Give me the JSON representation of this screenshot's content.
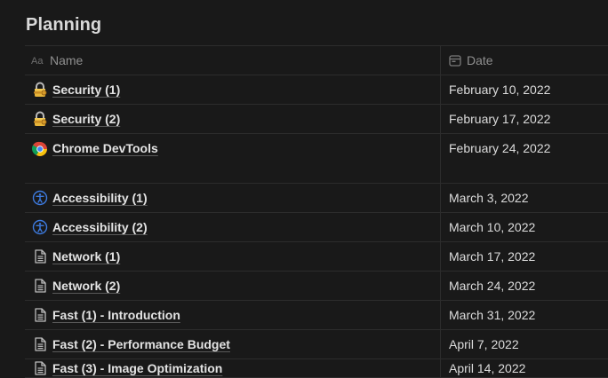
{
  "page": {
    "title": "Planning"
  },
  "table": {
    "columns": {
      "name": {
        "label": "Name",
        "icon": "text-property-icon"
      },
      "date": {
        "label": "Date",
        "icon": "calendar-icon"
      }
    },
    "rows": [
      {
        "name": "Security (1)",
        "date": "February 10, 2022",
        "icon": "lock-key-icon"
      },
      {
        "name": "Security (2)",
        "date": "February 17, 2022",
        "icon": "lock-key-icon"
      },
      {
        "name": "Chrome DevTools",
        "date": "February 24, 2022",
        "icon": "chrome-icon"
      },
      {
        "name": "Accessibility (1)",
        "date": "March 3, 2022",
        "icon": "accessibility-icon"
      },
      {
        "name": "Accessibility (2)",
        "date": "March 10, 2022",
        "icon": "accessibility-icon"
      },
      {
        "name": "Network (1)",
        "date": "March 17, 2022",
        "icon": "document-icon"
      },
      {
        "name": "Network (2)",
        "date": "March 24, 2022",
        "icon": "document-icon"
      },
      {
        "name": "Fast (1) - Introduction",
        "date": "March 31, 2022",
        "icon": "document-icon"
      },
      {
        "name": "Fast (2) - Performance Budget",
        "date": "April 7, 2022",
        "icon": "document-icon"
      },
      {
        "name": "Fast (3) - Image Optimization",
        "date": "April 14, 2022",
        "icon": "document-icon"
      }
    ]
  }
}
